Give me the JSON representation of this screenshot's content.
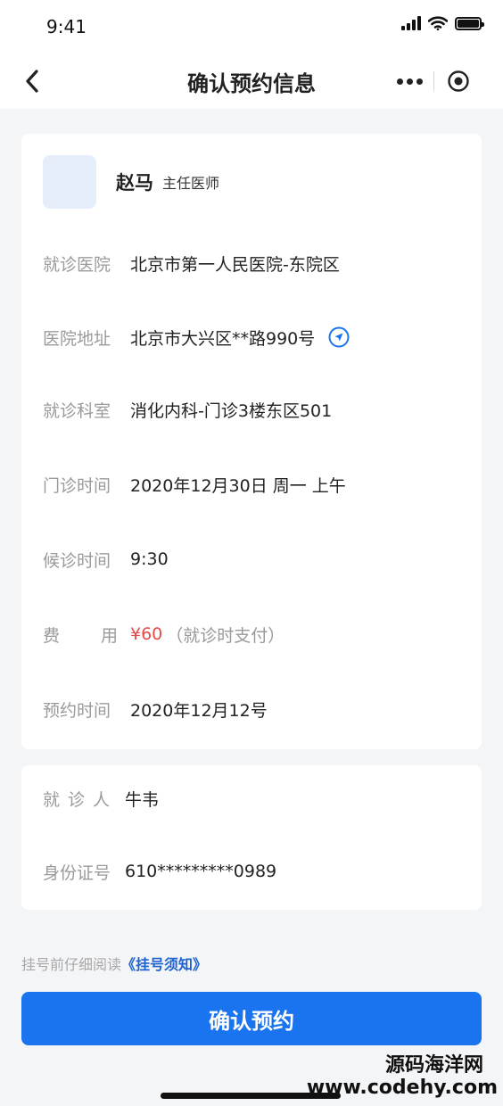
{
  "status_bar": {
    "time": "9:41"
  },
  "nav": {
    "title": "确认预约信息",
    "back_icon": "chevron-left-icon",
    "more_icon": "more-dots-icon",
    "close_icon": "target-circle-icon"
  },
  "doctor": {
    "name": "赵马",
    "title": "主任医师"
  },
  "appointment": {
    "hospital": {
      "label": "就诊医院",
      "value": "北京市第一人民医院-东院区"
    },
    "address": {
      "label": "医院地址",
      "value": "北京市大兴区**路990号",
      "icon": "navigation-arrow-icon"
    },
    "department": {
      "label": "就诊科室",
      "value": "消化内科-门诊3楼东区501"
    },
    "clinic_time": {
      "label": "门诊时间",
      "value": "2020年12月30日 周一 上午"
    },
    "wait_time": {
      "label": "候诊时间",
      "value": "9:30"
    },
    "fee": {
      "label_a": "费",
      "label_b": "用",
      "price": "¥60",
      "note": "（就诊时支付）"
    },
    "booking_time": {
      "label": "预约时间",
      "value": "2020年12月12号"
    }
  },
  "patient": {
    "name": {
      "label": "就诊人",
      "value": "牛韦"
    },
    "id_card": {
      "label": "身份证号",
      "value": "610*********0989"
    }
  },
  "notice": {
    "text": "挂号前仔细阅读",
    "link": "《挂号须知》"
  },
  "confirm_button": {
    "label": "确认预约"
  },
  "watermark": {
    "cn": "源码海洋网",
    "url": "www.codehy.com"
  },
  "colors": {
    "primary": "#1a73ef",
    "link": "#1e62d0",
    "price": "#e64a4a",
    "label": "#9a9a9a"
  }
}
